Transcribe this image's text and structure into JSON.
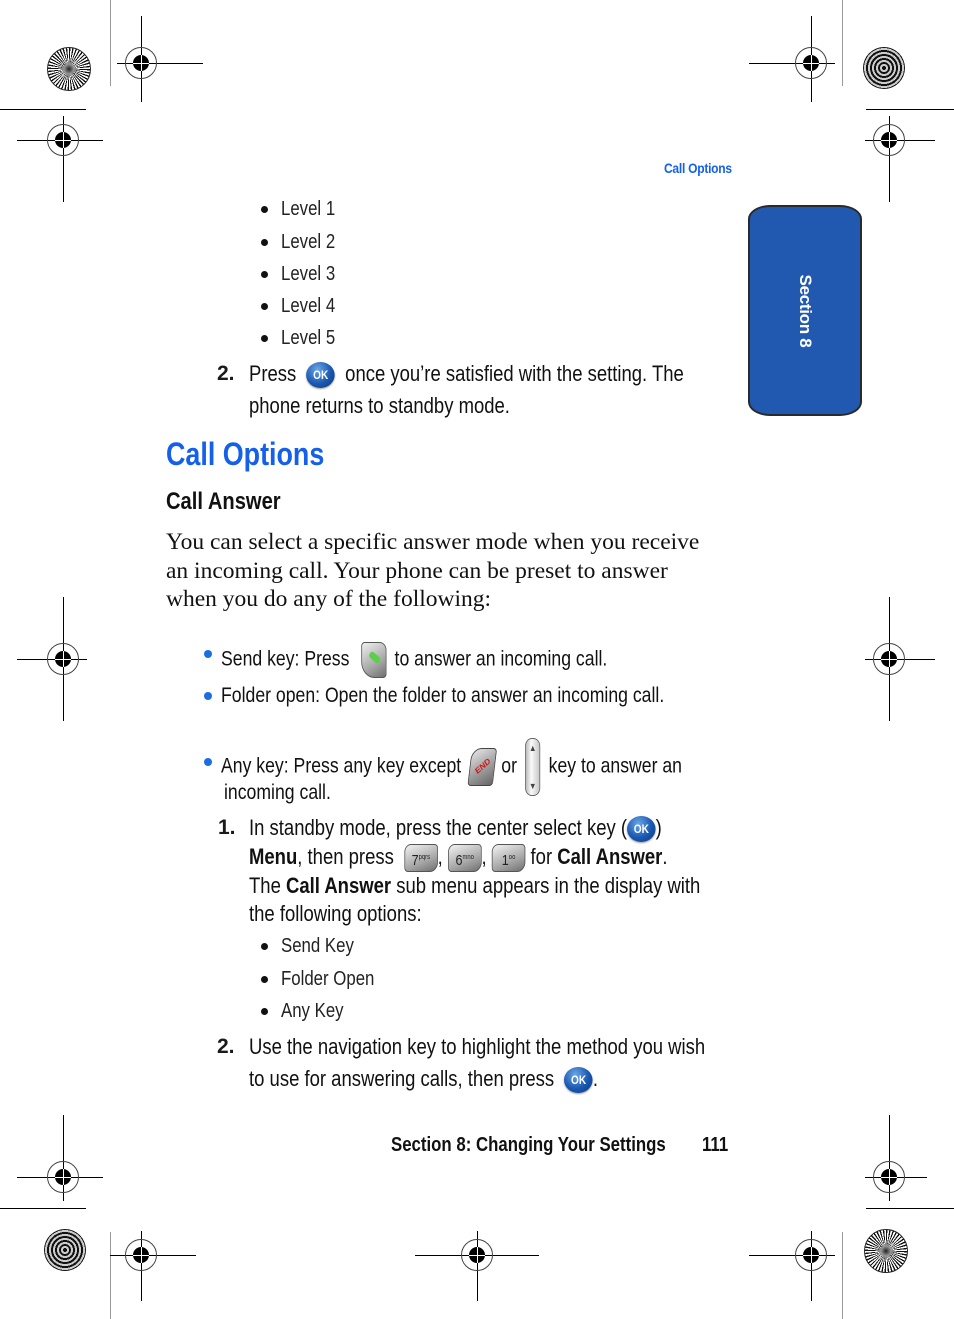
{
  "running_head": "Call Options",
  "section_tab": "Section 8",
  "level_list": [
    "Level 1",
    "Level 2",
    "Level 3",
    "Level 4",
    "Level 5"
  ],
  "step2_top": {
    "number": "2.",
    "press": "Press",
    "after_icon": "once you’re satisfied with the setting. The",
    "line2": "phone returns to standby mode."
  },
  "heading": "Call Options",
  "subheading": "Call Answer",
  "intro_lines": [
    "You can select a specific answer mode when you receive",
    "an incoming call. Your phone can be preset to answer",
    "when you do any of the following:"
  ],
  "answer_modes": {
    "send_key": {
      "before": "Send key: Press",
      "after": "to answer an incoming call."
    },
    "folder_open": {
      "text": "Folder open: Open the folder to answer an incoming call."
    },
    "any_key": {
      "before": "Any key: Press any key except",
      "or": "or",
      "after": "key to answer an",
      "line2": "incoming call."
    }
  },
  "step1": {
    "number": "1.",
    "line1_before": "In standby mode, press the center select key (",
    "line1_after": ")",
    "menu_bold": "Menu",
    "line2_mid": ", then press",
    "comma": ",",
    "for": "for",
    "call_answer_bold": "Call Answer",
    "period": ".",
    "line3_the": "The",
    "line3_after": "sub menu appears in the display with",
    "line4": "the following options:"
  },
  "submenu_options": [
    "Send Key",
    "Folder Open",
    "Any Key"
  ],
  "step2_bottom": {
    "number": "2.",
    "line1": "Use the navigation key to highlight the method you wish",
    "line2": "to use for answering calls, then press",
    "end": "."
  },
  "keys": {
    "ok": "OK",
    "end": "END",
    "seven": {
      "digit": "7",
      "letters": "pqrs"
    },
    "six": {
      "digit": "6",
      "letters": "mno"
    },
    "one": {
      "digit": "1",
      "letters": "oo"
    },
    "nav_up": "▲",
    "nav_down": "▼"
  },
  "footer": "Section 8: Changing Your Settings",
  "page_number": "111",
  "colors": {
    "accent_blue": "#1560e8",
    "section_tab": "#2159b0"
  }
}
